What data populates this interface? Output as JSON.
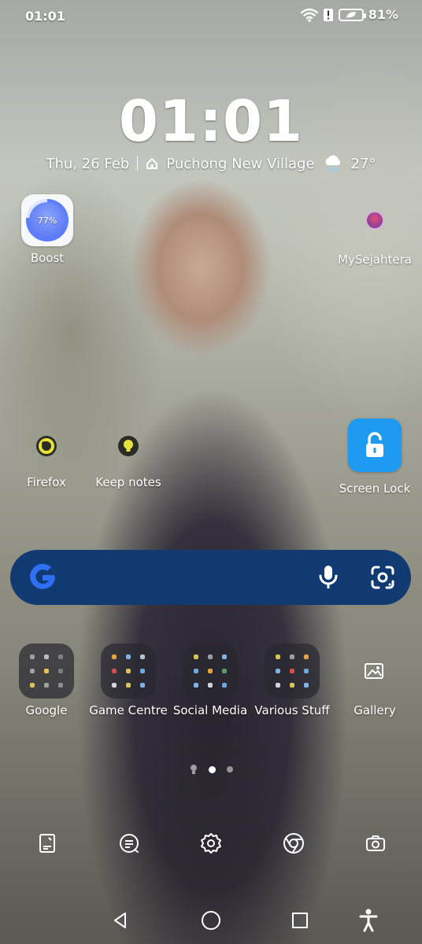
{
  "status_bar": {
    "time": "01:01",
    "battery_percent": "81%",
    "icons": [
      "wifi-icon",
      "alert-icon",
      "battery-saver-icon"
    ]
  },
  "clock_widget": {
    "time": "01:01",
    "date": "Thu, 26 Feb",
    "location": "Puchong New Village",
    "weather_temp": "27°",
    "weather_icon": "cloud-rain-icon"
  },
  "apps_row1": {
    "boost": {
      "label": "Boost",
      "percent": "77%"
    },
    "mysejahtera": {
      "label": "MySejahtera"
    }
  },
  "apps_row2": {
    "firefox": {
      "label": "Firefox"
    },
    "keep_notes": {
      "label": "Keep notes"
    },
    "screen_lock": {
      "label": "Screen Lock"
    }
  },
  "search_bar": {
    "logo": "G",
    "icons": [
      "google-logo-icon",
      "microphone-icon",
      "google-lens-icon"
    ]
  },
  "folders": [
    {
      "label": "Google"
    },
    {
      "label": "Game Centre"
    },
    {
      "label": "Social Media"
    },
    {
      "label": "Various Stuff"
    }
  ],
  "gallery": {
    "label": "Gallery"
  },
  "page_indicator": {
    "pages": 3,
    "current": 2
  },
  "dock": [
    "notes-app-icon",
    "messages-icon",
    "settings-icon",
    "chrome-icon",
    "camera-icon"
  ],
  "navigation": [
    "back-icon",
    "home-icon",
    "recents-icon",
    "accessibility-icon"
  ],
  "colors": {
    "search_bg": "#113a73",
    "boost_accent": "#5d7dff",
    "screen_lock_bg": "#1e9bf0"
  }
}
